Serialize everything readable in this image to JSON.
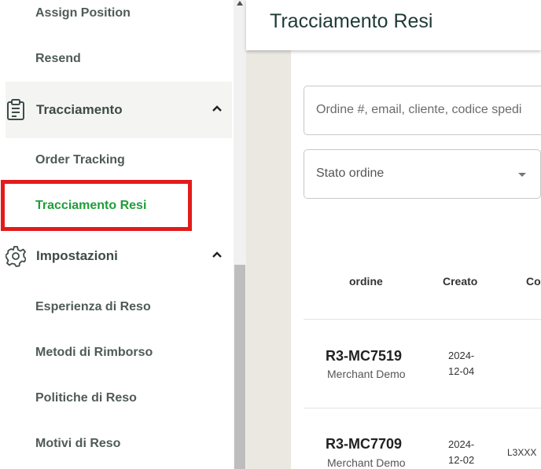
{
  "sidebar": {
    "top_items": [
      {
        "label": "Assign Position"
      },
      {
        "label": "Resend"
      }
    ],
    "tracking_group": {
      "label": "Tracciamento",
      "icon": "clipboard-icon",
      "expanded": true,
      "items": [
        {
          "label": "Order Tracking"
        },
        {
          "label": "Tracciamento Resi",
          "selected": true
        }
      ]
    },
    "settings_group": {
      "label": "Impostazioni",
      "icon": "gear-icon",
      "expanded": true,
      "items": [
        {
          "label": "Esperienza di Reso"
        },
        {
          "label": "Metodi di Rimborso"
        },
        {
          "label": "Politiche di Reso"
        },
        {
          "label": "Motivi di Reso"
        }
      ]
    }
  },
  "header": {
    "title": "Tracciamento Resi"
  },
  "filters": {
    "search_placeholder": "Ordine #, email, cliente, codice spedi",
    "status_placeholder": "Stato ordine"
  },
  "table": {
    "columns": [
      "ordine",
      "Creato",
      "Co"
    ],
    "rows": [
      {
        "order": "R3-MC7519",
        "merchant": "Merchant Demo",
        "created": "2024-\n12-04",
        "code": ""
      },
      {
        "order": "R3-MC7709",
        "merchant": "Merchant Demo",
        "created": "2024-\n12-02",
        "code": "L3XXX"
      }
    ]
  },
  "colors": {
    "accent_green": "#1f9d3a",
    "highlight_red": "#e31b1b",
    "title_color": "#1f3a36"
  }
}
